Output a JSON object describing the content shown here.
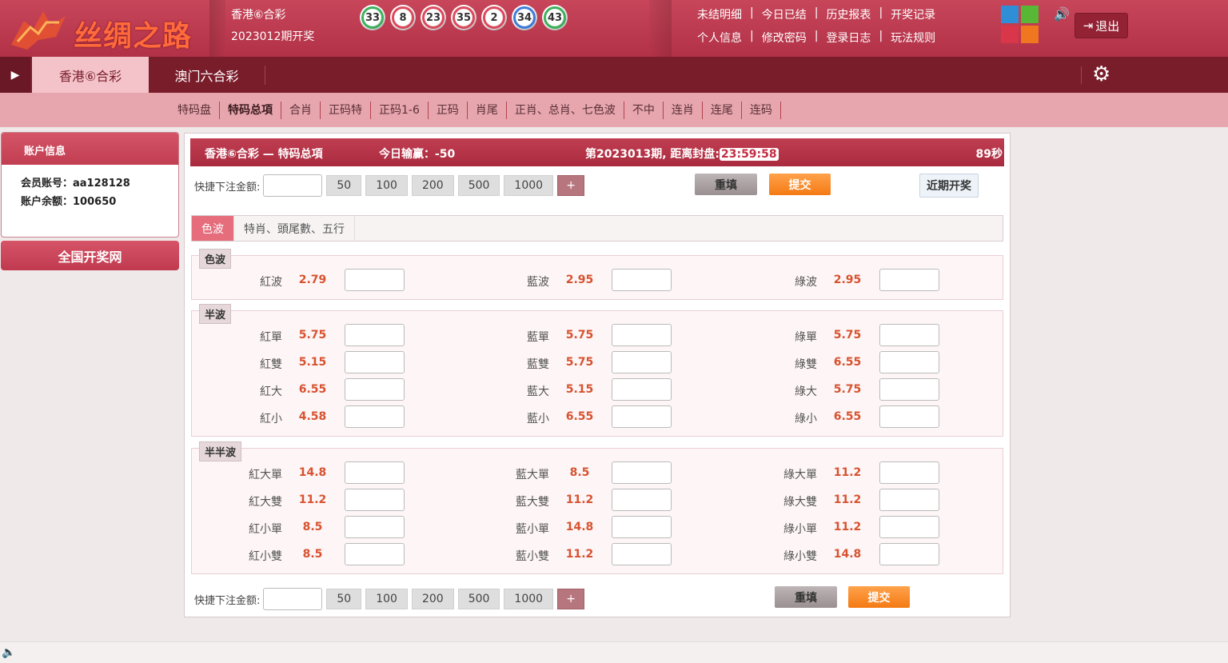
{
  "header": {
    "logo_text": "丝绸之路",
    "lottery_title": "香港⑥合彩",
    "issue_text": "2023012期开奖",
    "balls": [
      {
        "num": "33",
        "color": "#2aa84a"
      },
      {
        "num": "8",
        "color": "#d9364a"
      },
      {
        "num": "23",
        "color": "#d9364a"
      },
      {
        "num": "35",
        "color": "#d9364a"
      },
      {
        "num": "2",
        "color": "#d9364a"
      },
      {
        "num": "34",
        "color": "#2b6fd6"
      },
      {
        "num": "43",
        "color": "#2aa84a"
      }
    ],
    "links_row1": [
      "未结明细",
      "今日已结",
      "历史报表",
      "开奖记录"
    ],
    "links_row2": [
      "个人信息",
      "修改密码",
      "登录日志",
      "玩法规则"
    ],
    "theme_colors": [
      "#2f8fd6",
      "#58b734",
      "#d9364a",
      "#f07620"
    ],
    "logout_label": "退出"
  },
  "nav": {
    "tabs": [
      "香港⑥合彩",
      "澳门六合彩"
    ]
  },
  "subnav": {
    "items": [
      "特码盘",
      "特码总項",
      "合肖",
      "正码特",
      "正码1-6",
      "正码",
      "肖尾",
      "正肖、总肖、七色波",
      "不中",
      "连肖",
      "连尾",
      "连码"
    ],
    "active": "特码总項"
  },
  "sidebar": {
    "title": "账户信息",
    "member_label": "会员账号：",
    "member_value": "aa128128",
    "balance_label": "账户余额：",
    "balance_value": "100650",
    "site_button": "全国开奖网"
  },
  "status": {
    "title": "香港⑥合彩 — 特码总項",
    "today_label": "今日输赢：",
    "today_value": "-50",
    "period_label": "第2023013期, 距离封盘:",
    "timer": "23:59:58",
    "countdown": "89秒"
  },
  "quick": {
    "label": "快捷下注金额:",
    "chips": [
      "50",
      "100",
      "200",
      "500",
      "1000"
    ],
    "plus": "+",
    "reset": "重填",
    "submit": "提交",
    "recent": "近期开奖"
  },
  "subtabs": [
    "色波",
    "特肖、頭尾數、五行"
  ],
  "sections": [
    {
      "label": "色波",
      "rows": [
        [
          {
            "name": "紅波",
            "odds": "2.79"
          },
          {
            "name": "藍波",
            "odds": "2.95"
          },
          {
            "name": "綠波",
            "odds": "2.95"
          }
        ]
      ]
    },
    {
      "label": "半波",
      "rows": [
        [
          {
            "name": "紅單",
            "odds": "5.75"
          },
          {
            "name": "藍單",
            "odds": "5.75"
          },
          {
            "name": "綠單",
            "odds": "5.75"
          }
        ],
        [
          {
            "name": "紅雙",
            "odds": "5.15"
          },
          {
            "name": "藍雙",
            "odds": "5.75"
          },
          {
            "name": "綠雙",
            "odds": "6.55"
          }
        ],
        [
          {
            "name": "紅大",
            "odds": "6.55"
          },
          {
            "name": "藍大",
            "odds": "5.15"
          },
          {
            "name": "綠大",
            "odds": "5.75"
          }
        ],
        [
          {
            "name": "紅小",
            "odds": "4.58"
          },
          {
            "name": "藍小",
            "odds": "6.55"
          },
          {
            "name": "綠小",
            "odds": "6.55"
          }
        ]
      ]
    },
    {
      "label": "半半波",
      "rows": [
        [
          {
            "name": "紅大單",
            "odds": "14.8"
          },
          {
            "name": "藍大單",
            "odds": "8.5"
          },
          {
            "name": "綠大單",
            "odds": "11.2"
          }
        ],
        [
          {
            "name": "紅大雙",
            "odds": "11.2"
          },
          {
            "name": "藍大雙",
            "odds": "11.2"
          },
          {
            "name": "綠大雙",
            "odds": "11.2"
          }
        ],
        [
          {
            "name": "紅小單",
            "odds": "8.5"
          },
          {
            "name": "藍小單",
            "odds": "14.8"
          },
          {
            "name": "綠小單",
            "odds": "11.2"
          }
        ],
        [
          {
            "name": "紅小雙",
            "odds": "8.5"
          },
          {
            "name": "藍小雙",
            "odds": "11.2"
          },
          {
            "name": "綠小雙",
            "odds": "14.8"
          }
        ]
      ]
    }
  ]
}
